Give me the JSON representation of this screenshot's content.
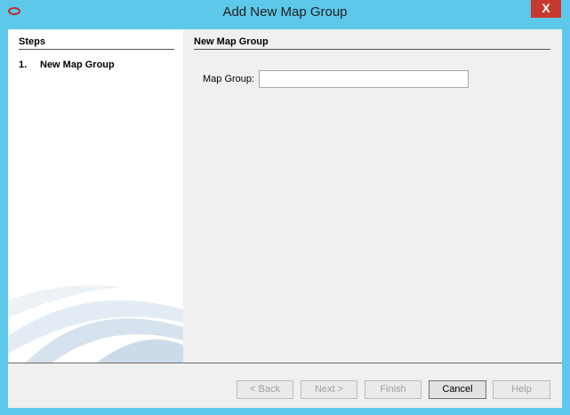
{
  "window": {
    "title": "Add New Map Group",
    "close_label": "X"
  },
  "steps": {
    "title": "Steps",
    "items": [
      {
        "number": "1.",
        "label": "New Map Group"
      }
    ]
  },
  "panel": {
    "title": "New Map Group",
    "field_label": "Map Group:",
    "field_value": ""
  },
  "buttons": {
    "back": "< Back",
    "next": "Next >",
    "finish": "Finish",
    "cancel": "Cancel",
    "help": "Help"
  },
  "colors": {
    "titlebar": "#5ec8eb",
    "close": "#c7392f",
    "app_icon": "#c0282d"
  }
}
